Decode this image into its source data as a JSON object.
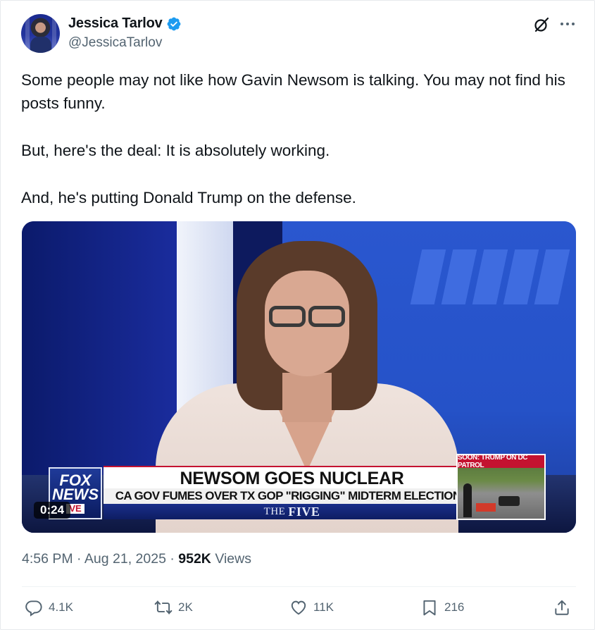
{
  "author": {
    "display_name": "Jessica Tarlov",
    "handle": "@JessicaTarlov",
    "verified": true,
    "verified_color": "#1d9bf0"
  },
  "post": {
    "paragraphs": [
      "Some people may not like how Gavin Newsom is talking. You may not find his posts funny.",
      "But, here's the deal: It is absolutely working.",
      "And, he's putting Donald Trump on the defense."
    ]
  },
  "video": {
    "duration": "0:24",
    "logo_line1": "FOX",
    "logo_line2": "NEWS",
    "logo_live": "VE",
    "headline": "NEWSOM GOES NUCLEAR",
    "subheadline": "CA GOV FUMES OVER TX GOP \"RIGGING\" MIDTERM ELECTIONS",
    "show_prefix": "THE",
    "show_name": "FIVE",
    "inset_label": "SOON: TRUMP ON DC PATROL"
  },
  "meta": {
    "time": "4:56 PM",
    "separator": "·",
    "date": "Aug 21, 2025",
    "views_count": "952K",
    "views_label": "Views"
  },
  "actions": {
    "replies": "4.1K",
    "reposts": "2K",
    "likes": "11K",
    "bookmarks": "216"
  },
  "icons": [
    "verified-badge-icon",
    "grok-icon",
    "more-icon",
    "reply-icon",
    "repost-icon",
    "like-icon",
    "bookmark-icon",
    "share-icon"
  ]
}
